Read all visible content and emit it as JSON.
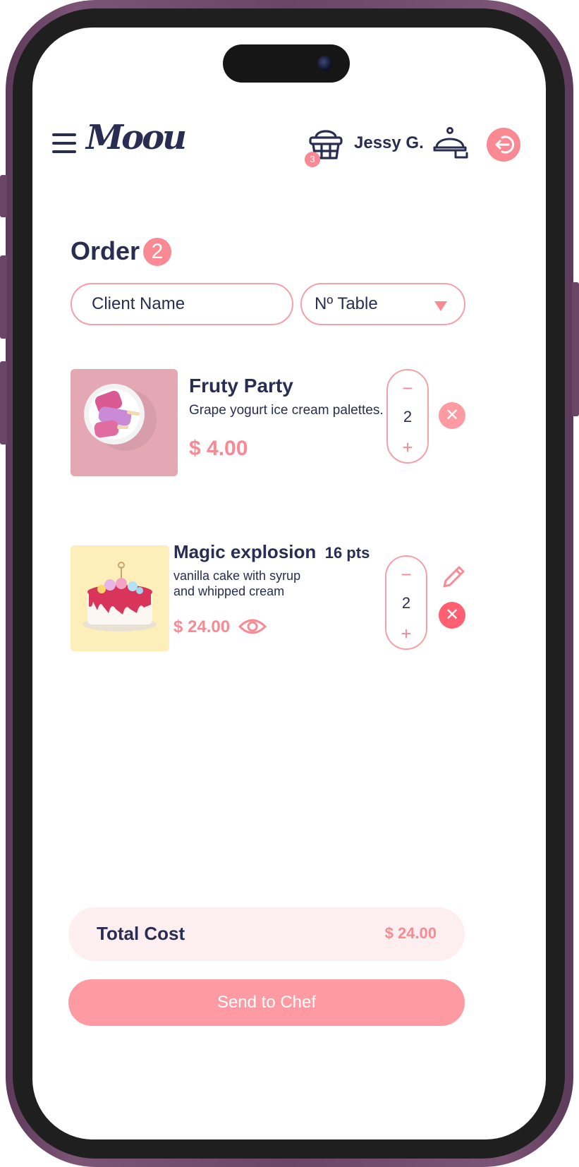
{
  "colors": {
    "accent": "#f98a94",
    "text": "#2a2d52",
    "danger": "#ff6071",
    "light_accent": "#fdeff0"
  },
  "header": {
    "logo_text": "Moou",
    "cart_count": "3",
    "user_name": "Jessy G.",
    "icons": [
      "menu-icon",
      "basket-icon",
      "cloche-icon",
      "logout-icon"
    ]
  },
  "order": {
    "title": "Order",
    "count": "2",
    "client_name_placeholder": "Client Name",
    "table_selected": "Nº Table"
  },
  "items": [
    {
      "name": "Fruty Party",
      "description": "Grape yogurt ice cream palettes.",
      "price": "$ 4.00",
      "quantity": "2",
      "minus": "−",
      "plus": "+",
      "remove": "✕"
    },
    {
      "name": "Magic explosion",
      "points": "16 pts",
      "description_line1": "vanilla cake with syrup",
      "description_line2": "and whipped cream",
      "price": "$ 24.00",
      "quantity": "2",
      "minus": "−",
      "plus": "+",
      "remove": "✕"
    }
  ],
  "footer": {
    "total_label": "Total Cost",
    "total_value": "$ 24.00",
    "send_label": "Send to Chef"
  }
}
